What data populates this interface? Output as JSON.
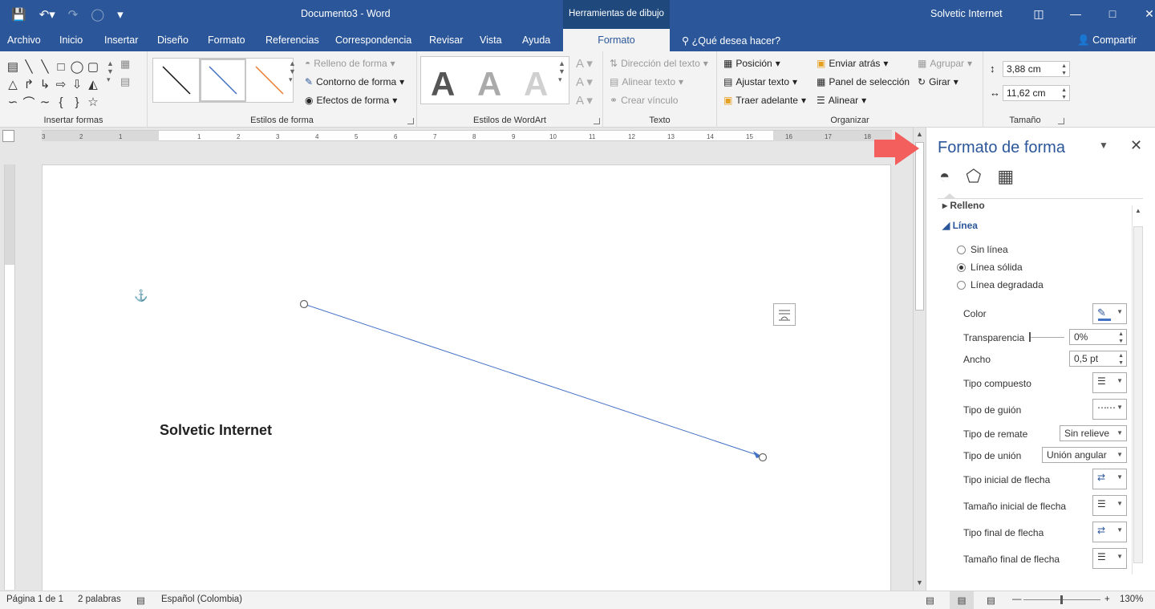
{
  "title_bar": {
    "doc_title": "Documento3  -  Word",
    "tools_tab": "Herramientas de dibujo",
    "user": "Solvetic Internet"
  },
  "menu": {
    "tabs": [
      "Archivo",
      "Inicio",
      "Insertar",
      "Diseño",
      "Formato",
      "Referencias",
      "Correspondencia",
      "Revisar",
      "Vista",
      "Ayuda"
    ],
    "active_tab": "Formato",
    "search_placeholder": "¿Qué desea hacer?",
    "share": "Compartir"
  },
  "ribbon": {
    "groups": {
      "insert_shapes": "Insertar formas",
      "shape_styles": "Estilos de forma",
      "wordart_styles": "Estilos de WordArt",
      "text": "Texto",
      "arrange": "Organizar",
      "size": "Tamaño"
    },
    "shape_fill": "Relleno de forma",
    "shape_outline": "Contorno de forma",
    "shape_effects": "Efectos de forma",
    "text_direction": "Dirección del texto",
    "align_text": "Alinear texto",
    "create_link": "Crear vínculo",
    "position": "Posición",
    "wrap_text": "Ajustar texto",
    "bring_forward": "Traer adelante",
    "send_backward": "Enviar atrás",
    "selection_pane": "Panel de selección",
    "align": "Alinear",
    "group": "Agrupar",
    "rotate": "Girar",
    "height": "3,88 cm",
    "width": "11,62 cm"
  },
  "document": {
    "text": "Solvetic Internet"
  },
  "format_pane": {
    "title": "Formato de forma",
    "section_fill": "Relleno",
    "section_line": "Línea",
    "radios": [
      {
        "label": "Sin línea",
        "checked": false
      },
      {
        "label": "Línea sólida",
        "checked": true
      },
      {
        "label": "Línea degradada",
        "checked": false
      }
    ],
    "color_label": "Color",
    "transparency_label": "Transparencia",
    "transparency_value": "0%",
    "width_label": "Ancho",
    "width_value": "0,5 pt",
    "compound_label": "Tipo compuesto",
    "dash_label": "Tipo de guión",
    "cap_label": "Tipo de remate",
    "cap_value": "Sin relieve",
    "join_label": "Tipo de unión",
    "join_value": "Unión angular",
    "begin_arrow_type": "Tipo inicial de flecha",
    "begin_arrow_size": "Tamaño inicial de flecha",
    "end_arrow_type": "Tipo final de flecha",
    "end_arrow_size": "Tamaño final de flecha"
  },
  "status_bar": {
    "page": "Página 1 de 1",
    "words": "2 palabras",
    "language": "Español (Colombia)",
    "zoom": "130%"
  },
  "colors": {
    "brand": "#2b579a",
    "line": "#4472c4",
    "arrow": "#f25f5c"
  },
  "icons": [
    "save-icon",
    "undo-icon",
    "redo-icon",
    "repeat-icon",
    "qat-dropdown-icon",
    "search-icon",
    "share-icon",
    "fill-line-icon",
    "effects-icon",
    "layout-size-icon",
    "anchor-icon",
    "layout-options-icon",
    "proofing-icon"
  ]
}
